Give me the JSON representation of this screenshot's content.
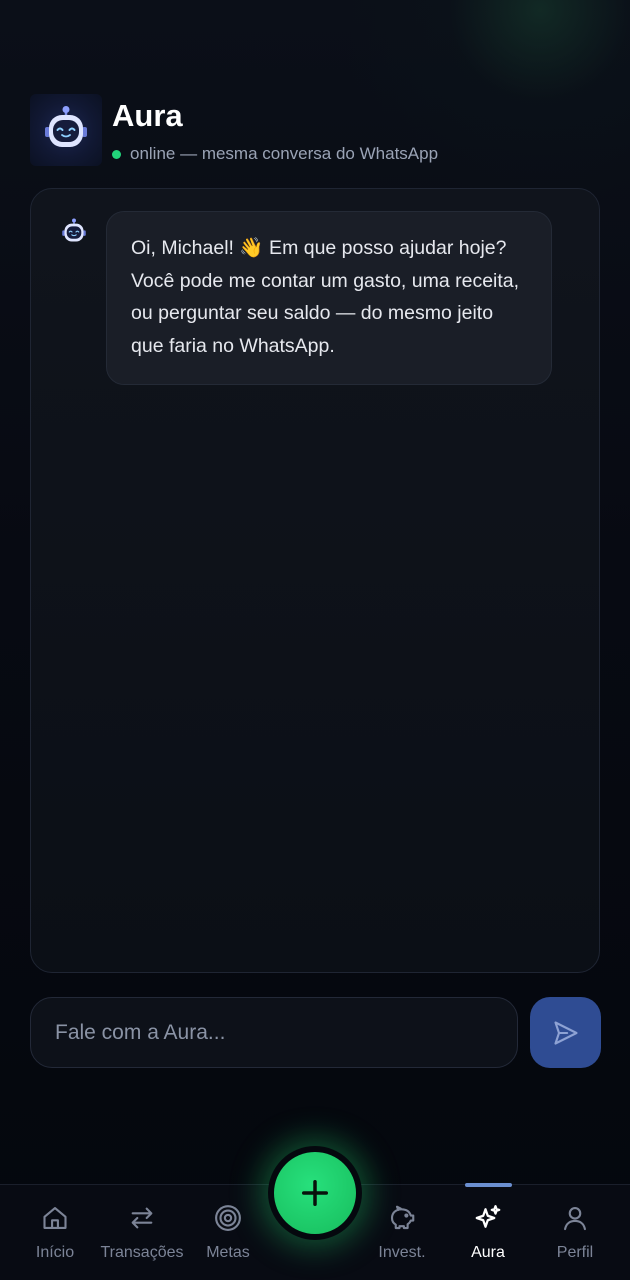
{
  "header": {
    "title": "Aura",
    "status": "online — mesma conversa do WhatsApp"
  },
  "chat": {
    "messages": [
      {
        "sender": "Aura",
        "text": "Oi, Michael! 👋 Em que posso ajudar hoje? Você pode me contar um gasto, uma receita, ou perguntar seu saldo — do mesmo jeito que faria no WhatsApp."
      }
    ]
  },
  "composer": {
    "placeholder": "Fale com a Aura...",
    "value": ""
  },
  "nav": {
    "items": [
      {
        "label": "Início",
        "icon": "home-icon"
      },
      {
        "label": "Transações",
        "icon": "arrows-swap-icon"
      },
      {
        "label": "Metas",
        "icon": "target-icon"
      },
      {
        "label": "Invest.",
        "icon": "piggy-bank-icon"
      },
      {
        "label": "Aura",
        "icon": "sparkles-icon",
        "active": true
      },
      {
        "label": "Perfil",
        "icon": "user-icon"
      }
    ],
    "fab_icon": "plus-icon"
  },
  "colors": {
    "background": "#05080f",
    "accent_green": "#22d37a",
    "send_button": "#2f4c93",
    "bubble": "#1a1e27",
    "active_indicator": "#6b8fd0"
  }
}
